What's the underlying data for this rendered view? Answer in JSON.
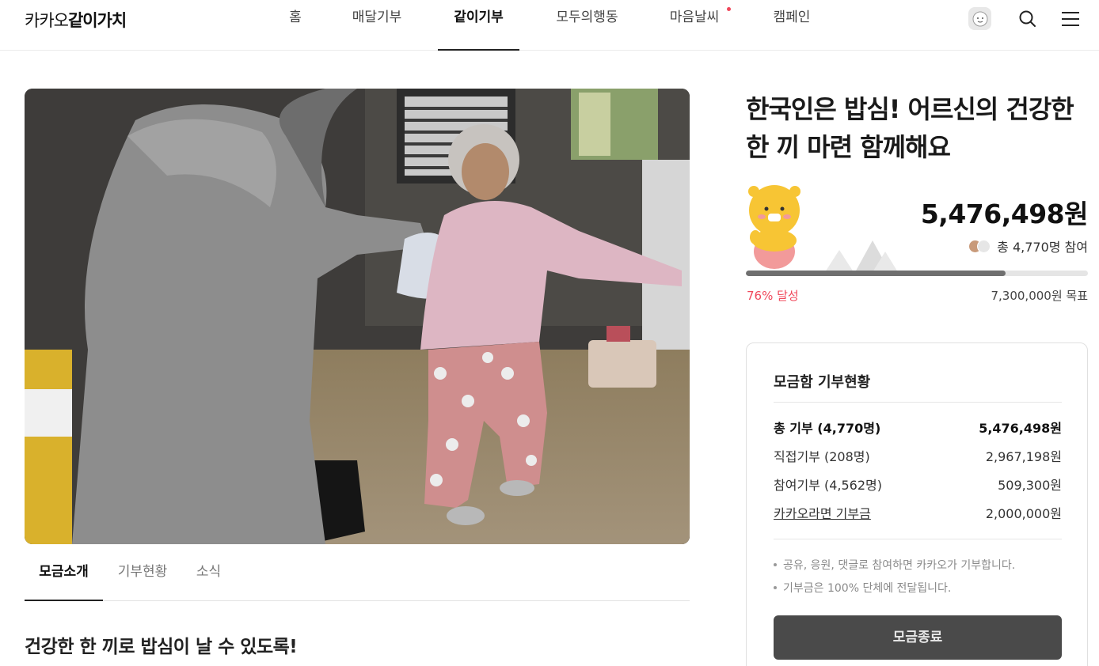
{
  "header": {
    "logo_light": "카카오",
    "logo_bold": "같이가치",
    "nav": [
      {
        "label": "홈"
      },
      {
        "label": "매달기부"
      },
      {
        "label": "같이기부"
      },
      {
        "label": "모두의행동"
      },
      {
        "label": "마음날씨"
      },
      {
        "label": "캠페인"
      }
    ],
    "icons": [
      "profile-avatar-icon",
      "search-icon",
      "menu-icon"
    ]
  },
  "hero": {
    "icon": "donation-photo-elderly-woman-receiving-meal"
  },
  "tabs": [
    {
      "label": "모금소개"
    },
    {
      "label": "기부현황"
    },
    {
      "label": "소식"
    }
  ],
  "section_title": "건강한 한 끼로 밥심이 날 수 있도록!",
  "campaign": {
    "title_line1": "한국인은 밥심! 어르신의 건강한",
    "title_line2": "한 끼 마련 함께해요",
    "amount": "5,476,498원",
    "participants": "총 4,770명 참여",
    "progress": 0.76,
    "percent_label": "76% 달성",
    "goal": "7,300,000원 목표",
    "mascot_icon": "kakao-choonsik-mascot-icon"
  },
  "status": {
    "title": "모금함 기부현황",
    "rows": [
      {
        "label": "총 기부 (4,770명)",
        "value": "5,476,498원"
      },
      {
        "label": "직접기부 (208명)",
        "value": "2,967,198원"
      },
      {
        "label": "참여기부 (4,562명)",
        "value": "509,300원"
      },
      {
        "label": "카카오라면 기부금",
        "value": "2,000,000원"
      }
    ],
    "notes": [
      "공유, 응원, 댓글로 참여하면 카카오가 기부합니다.",
      "기부금은 100% 단체에 전달됩니다."
    ],
    "button": "모금종료"
  },
  "colors": {
    "accent_red": "#f0475a",
    "progress_fill": "#6f6f6f",
    "button_bg": "#4a4a4a"
  }
}
